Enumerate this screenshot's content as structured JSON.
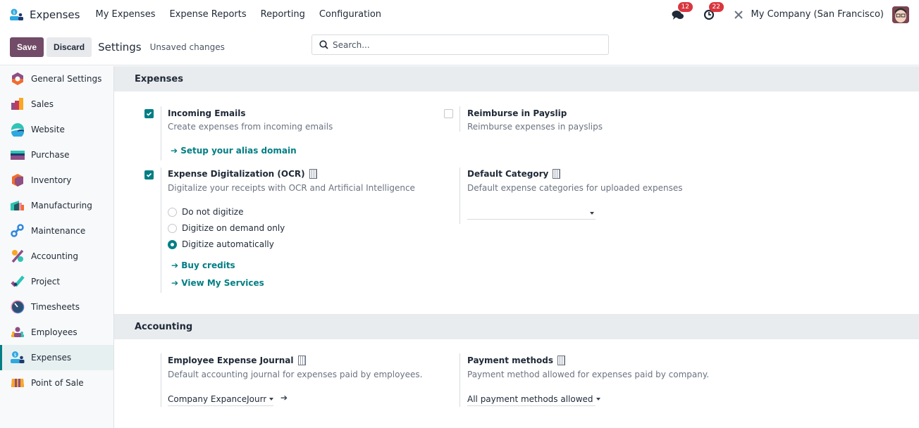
{
  "navbar": {
    "app_name": "Expenses",
    "menu": [
      "My Expenses",
      "Expense Reports",
      "Reporting",
      "Configuration"
    ],
    "messages_badge": "12",
    "activities_badge": "22",
    "company": "My Company (San Francisco)"
  },
  "control_panel": {
    "save_label": "Save",
    "discard_label": "Discard",
    "title": "Settings",
    "status": "Unsaved changes",
    "search_placeholder": "Search..."
  },
  "sidebar": {
    "items": [
      {
        "label": "General Settings",
        "icon": "general-settings-icon"
      },
      {
        "label": "Sales",
        "icon": "sales-icon"
      },
      {
        "label": "Website",
        "icon": "website-icon"
      },
      {
        "label": "Purchase",
        "icon": "purchase-icon"
      },
      {
        "label": "Inventory",
        "icon": "inventory-icon"
      },
      {
        "label": "Manufacturing",
        "icon": "manufacturing-icon"
      },
      {
        "label": "Maintenance",
        "icon": "maintenance-icon"
      },
      {
        "label": "Accounting",
        "icon": "accounting-icon"
      },
      {
        "label": "Project",
        "icon": "project-icon"
      },
      {
        "label": "Timesheets",
        "icon": "timesheets-icon"
      },
      {
        "label": "Employees",
        "icon": "employees-icon"
      },
      {
        "label": "Expenses",
        "icon": "expenses-icon",
        "active": true
      },
      {
        "label": "Point of Sale",
        "icon": "point-of-sale-icon"
      }
    ]
  },
  "sections": {
    "expenses": {
      "title": "Expenses",
      "incoming_emails": {
        "checked": true,
        "title": "Incoming Emails",
        "desc": "Create expenses from incoming emails",
        "link": "Setup your alias domain"
      },
      "reimburse_payslip": {
        "checked": false,
        "title": "Reimburse in Payslip",
        "desc": "Reimburse expenses in payslips"
      },
      "ocr": {
        "checked": true,
        "title": "Expense Digitalization (OCR)",
        "desc": "Digitalize your receipts with OCR and Artificial Intelligence",
        "options": [
          "Do not digitize",
          "Digitize on demand only",
          "Digitize automatically"
        ],
        "selected": "Digitize automatically",
        "link_buy": "Buy credits",
        "link_services": "View My Services"
      },
      "default_category": {
        "title": "Default Category",
        "desc": "Default expense categories for uploaded expenses",
        "value": ""
      }
    },
    "accounting": {
      "title": "Accounting",
      "journal": {
        "title": "Employee Expense Journal",
        "desc": "Default accounting journal for expenses paid by employees.",
        "value": "Company ExpanceJourna"
      },
      "payment_methods": {
        "title": "Payment methods",
        "desc": "Payment method allowed for expenses paid by company.",
        "value": "All payment methods allowed"
      }
    }
  },
  "link_arrow": "➔"
}
